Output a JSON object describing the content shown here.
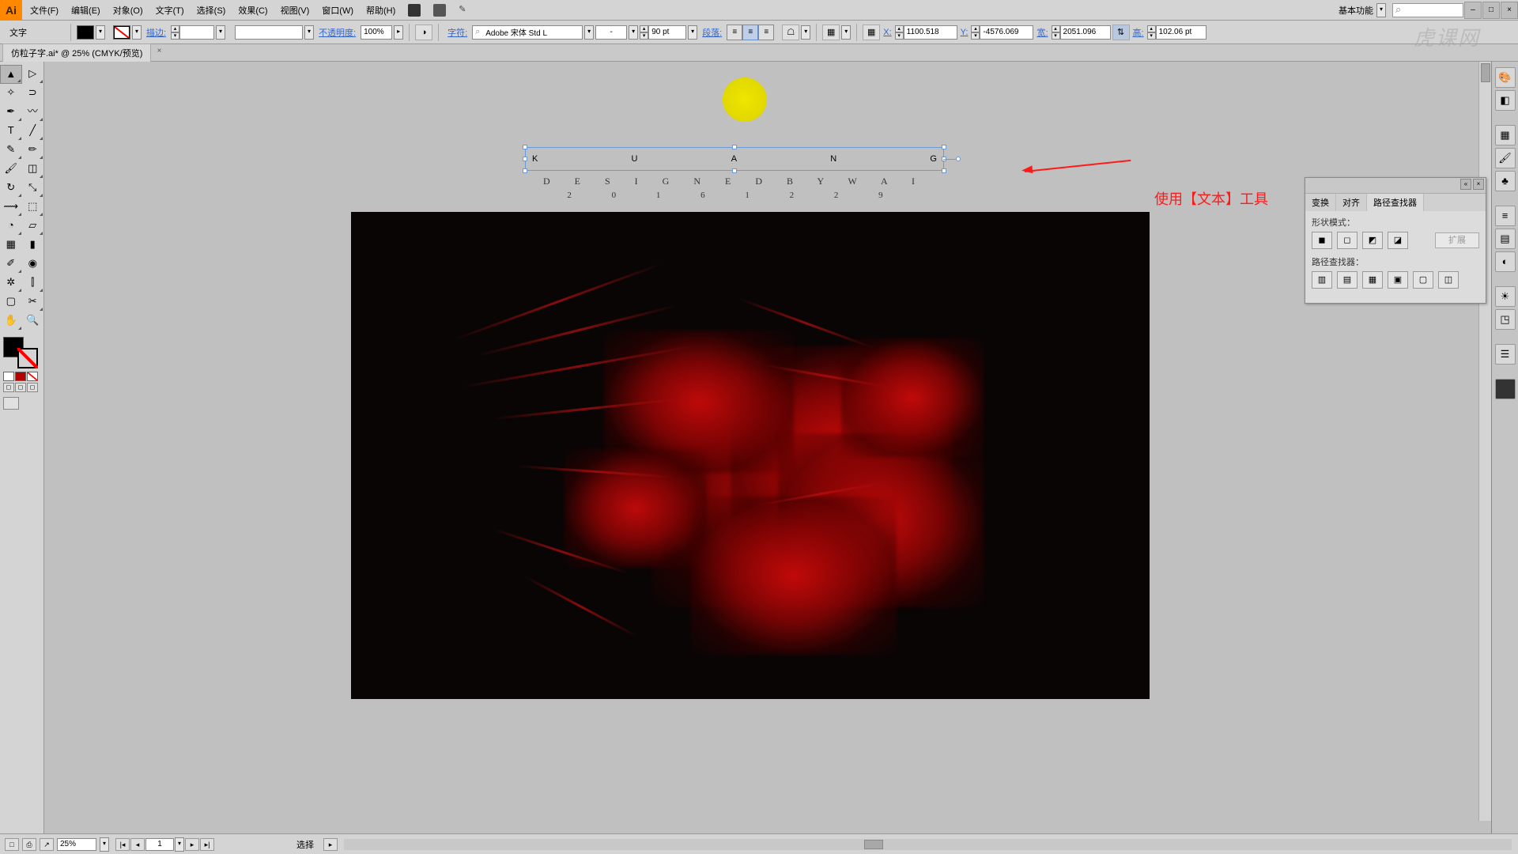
{
  "menu": {
    "items": [
      "文件(F)",
      "编辑(E)",
      "对象(O)",
      "文字(T)",
      "选择(S)",
      "效果(C)",
      "视图(V)",
      "窗口(W)",
      "帮助(H)"
    ]
  },
  "workspace_label": "基本功能",
  "window_controls": {
    "min": "–",
    "max": "□",
    "close": "×"
  },
  "tool_label": "文字",
  "control": {
    "stroke_label": "描边:",
    "stroke_input": "",
    "opacity_label": "不透明度:",
    "opacity_value": "100%",
    "char_label": "字符:",
    "font_name": "Adobe 宋体 Std L",
    "font_style": "-",
    "font_size": "90 pt",
    "para_label": "段落:",
    "x_label": "X:",
    "x_value": "1100.518",
    "y_label": "Y:",
    "y_value": "-4576.069",
    "w_label": "宽:",
    "w_value": "2051.096",
    "h_label": "高:",
    "h_value": "102.06 pt"
  },
  "doc_tab": "仿粒子字.ai* @ 25% (CMYK/预览)",
  "canvas": {
    "text_line1": [
      "K",
      "U",
      "A",
      "N",
      "G"
    ],
    "text_line2": "D E S I G N E D   B Y   W A I",
    "text_line3": "2 0 1 6  1 2  2 9"
  },
  "annotation": "使用【文本】工具",
  "panel": {
    "tabs": [
      "变换",
      "对齐",
      "路径查找器"
    ],
    "shape_mode_label": "形状模式：",
    "expand_label": "扩展",
    "pathfinder_label": "路径查找器："
  },
  "status": {
    "zoom": "25%",
    "page": "1",
    "tool": "选择"
  },
  "watermark": "虎课网"
}
